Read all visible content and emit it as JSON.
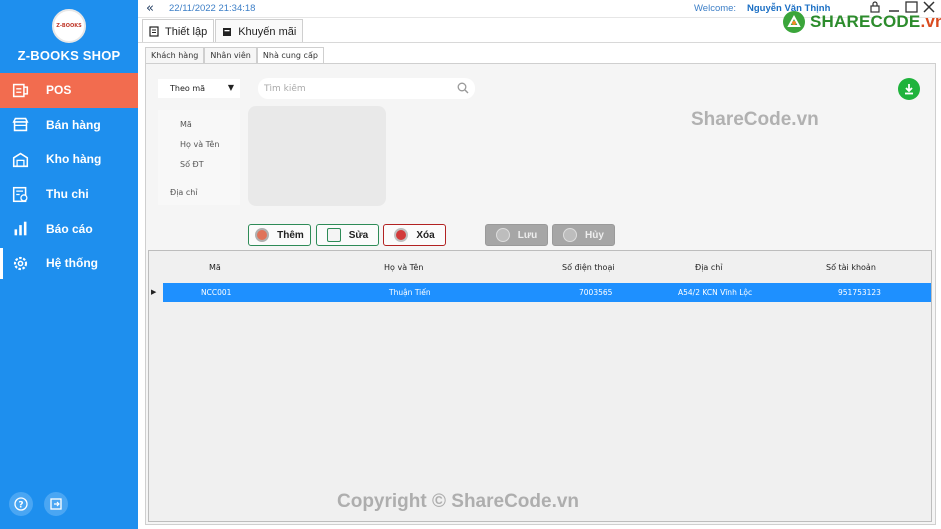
{
  "app": {
    "shop_name": "Z-BOOKS SHOP",
    "logo_text": "Z-BOOKS"
  },
  "sidebar": {
    "items": [
      {
        "label": "POS",
        "icon": "pos-receipt-icon"
      },
      {
        "label": "Bán hàng",
        "icon": "store-icon"
      },
      {
        "label": "Kho hàng",
        "icon": "warehouse-icon"
      },
      {
        "label": "Thu chi",
        "icon": "ledger-icon"
      },
      {
        "label": "Báo cáo",
        "icon": "bar-chart-icon"
      },
      {
        "label": "Hệ thống",
        "icon": "gear-icon"
      }
    ],
    "active_color": "#f26c4f",
    "bg_color": "#1e8fee"
  },
  "topbar": {
    "datetime": "22/11/2022 21:34:18",
    "welcome_label": "Welcome:",
    "username": "Nguyễn Văn Thịnh"
  },
  "main_tabs": [
    {
      "label": "Thiết lập",
      "icon": "settings-doc-icon"
    },
    {
      "label": "Khuyến mãi",
      "icon": "promo-icon"
    }
  ],
  "sub_tabs": [
    {
      "label": "Khách hàng"
    },
    {
      "label": "Nhân viên"
    },
    {
      "label": "Nhà cung cấp"
    }
  ],
  "search": {
    "mode": "Theo mã",
    "placeholder": "Tìm kiếm"
  },
  "form": {
    "labels": [
      "Mã",
      "Họ và Tên",
      "Số ĐT",
      "Địa chỉ"
    ]
  },
  "actions": {
    "add": "Thêm",
    "edit": "Sửa",
    "delete": "Xóa",
    "save": "Lưu",
    "cancel": "Hủy"
  },
  "table": {
    "columns": [
      "Mã",
      "Họ và Tên",
      "Số điện thoại",
      "Địa chỉ",
      "Số tài khoản"
    ],
    "rows": [
      {
        "ma": "NCC001",
        "ten": "Thuận Tiến",
        "sdt": "7003565",
        "dia_chi": "A54/2 KCN Vĩnh Lộc",
        "stk": "951753123"
      }
    ],
    "selected_color": "#1e90ff"
  },
  "watermark": {
    "logo_main": "SHARECODE",
    "logo_suffix": ".vn",
    "middle": "ShareCode.vn",
    "bottom": "Copyright © ShareCode.vn"
  }
}
